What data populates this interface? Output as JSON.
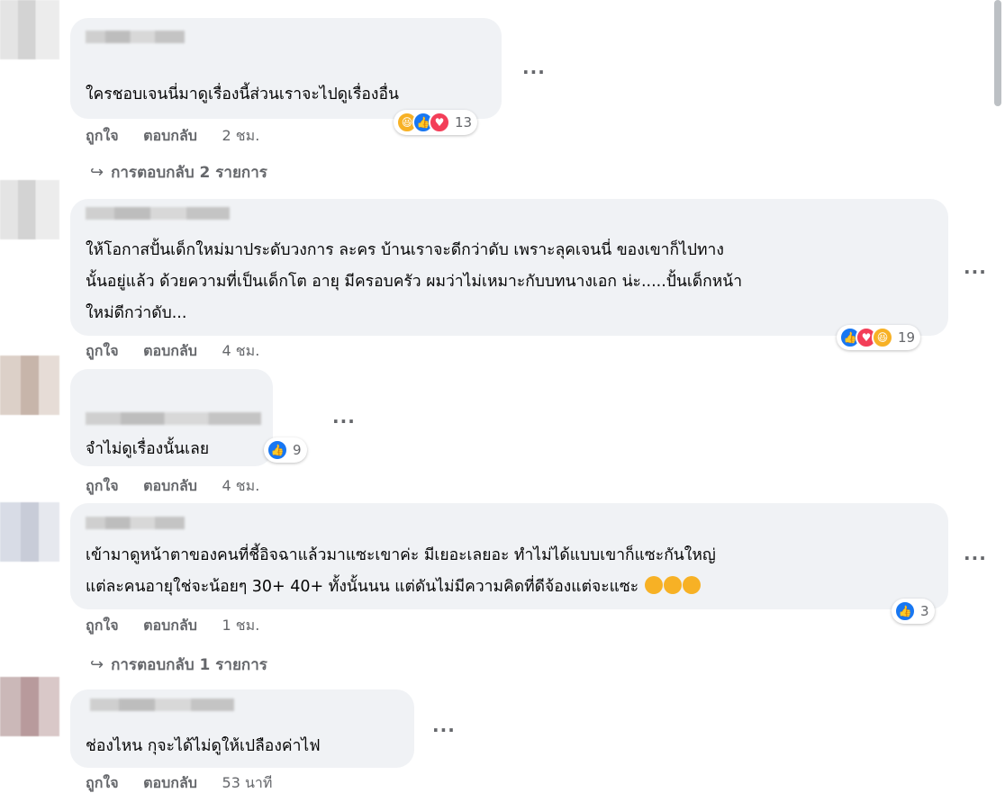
{
  "comments": [
    {
      "text_lines": [
        "ใครชอบเจนนี่มาดูเรื่องนี้ส่วนเราจะไปดูเรื่องอื่น"
      ],
      "actions": {
        "like": "ถูกใจ",
        "reply": "ตอบกลับ",
        "time": "2 ชม."
      },
      "reactions": [
        "haha",
        "like",
        "love"
      ],
      "reaction_count": "13",
      "replies_link": "การตอบกลับ 2 รายการ"
    },
    {
      "text_lines": [
        "ให้โอกาสปั้นเด็กใหม่มาประดับวงการ ละคร บ้านเราจะดีกว่าดับ เพราะลุคเจนนี่ ของเขาก็ไปทาง",
        "นั้นอยู่แล้ว ด้วยความที่เป็นเด็กโต อายุ มีครอบครัว ผมว่าไม่เหมาะกับบทนางเอก น่ะ.....ปั้นเด็กหน้า",
        "ใหม่ดีกว่าดับ..."
      ],
      "actions": {
        "like": "ถูกใจ",
        "reply": "ตอบกลับ",
        "time": "4 ชม."
      },
      "reactions": [
        "like",
        "love",
        "haha"
      ],
      "reaction_count": "19"
    },
    {
      "text_lines": [
        "จำไม่ดูเรื่องนั้นเลย"
      ],
      "actions": {
        "like": "ถูกใจ",
        "reply": "ตอบกลับ",
        "time": "4 ชม."
      },
      "reactions": [
        "like"
      ],
      "reaction_count": "9"
    },
    {
      "text_lines": [
        "เข้ามาดูหน้าตาของคนที่ชี้อิจฉาแล้วมาแซะเขาค่ะ มีเยอะเลยอะ ทำไม่ได้แบบเขาก็แซะกันใหญ่",
        "แต่ละคนอายุใช่จะน้อยๆ 30+ 40+ ทั้งนั้นนน แต่ดันไม่มีความคิดที่ดีจ้องแต่จะแซะ"
      ],
      "actions": {
        "like": "ถูกใจ",
        "reply": "ตอบกลับ",
        "time": "1 ชม."
      },
      "reactions": [
        "like"
      ],
      "reaction_count": "3",
      "replies_link": "การตอบกลับ 1 รายการ"
    },
    {
      "text_lines": [
        "ช่องไหน กุจะได้ไม่ดูให้เปลืองค่าไฟ"
      ],
      "actions": {
        "like": "ถูกใจ",
        "reply": "ตอบกลับ",
        "time": "53 นาที"
      }
    }
  ],
  "more_options_glyph": "···",
  "reply_arrow_glyph": "↪",
  "colors": {
    "bubble": "#f0f2f5",
    "secondary_text": "#65676b",
    "like": "#1877f2",
    "love": "#f33e58",
    "haha": "#f7b125"
  }
}
